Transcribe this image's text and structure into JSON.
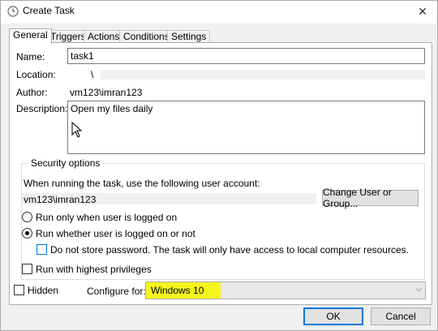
{
  "window": {
    "title": "Create Task",
    "close_glyph": "✕"
  },
  "tabs": [
    "General",
    "Triggers",
    "Actions",
    "Conditions",
    "Settings"
  ],
  "general": {
    "name_label": "Name:",
    "name_value": "task1",
    "location_label": "Location:",
    "location_value": "\\",
    "author_label": "Author:",
    "author_value": "vm123\\imran123",
    "description_label": "Description:",
    "description_value": "Open my files daily"
  },
  "security": {
    "title": "Security options",
    "account_prompt": "When running the task, use the following user account:",
    "account_value": "vm123\\imran123",
    "change_button": "Change User or Group...",
    "radio_logged_on": "Run only when user is logged on",
    "radio_logged_on_or_not": "Run whether user is logged on or not",
    "selected_radio": "Run whether user is logged on or not",
    "no_store_password": "Do not store password.  The task will only have access to local computer resources.",
    "highest_privileges": "Run with highest privileges"
  },
  "bottom": {
    "hidden_label": "Hidden",
    "configure_label": "Configure for:",
    "configure_value": "Windows 10",
    "highlight_color": "#f5f51e",
    "ok_button": "OK",
    "cancel_button": "Cancel"
  },
  "icons": [
    "task-clock-icon",
    "close-icon",
    "mouse-cursor-icon",
    "chevron-down-icon"
  ]
}
